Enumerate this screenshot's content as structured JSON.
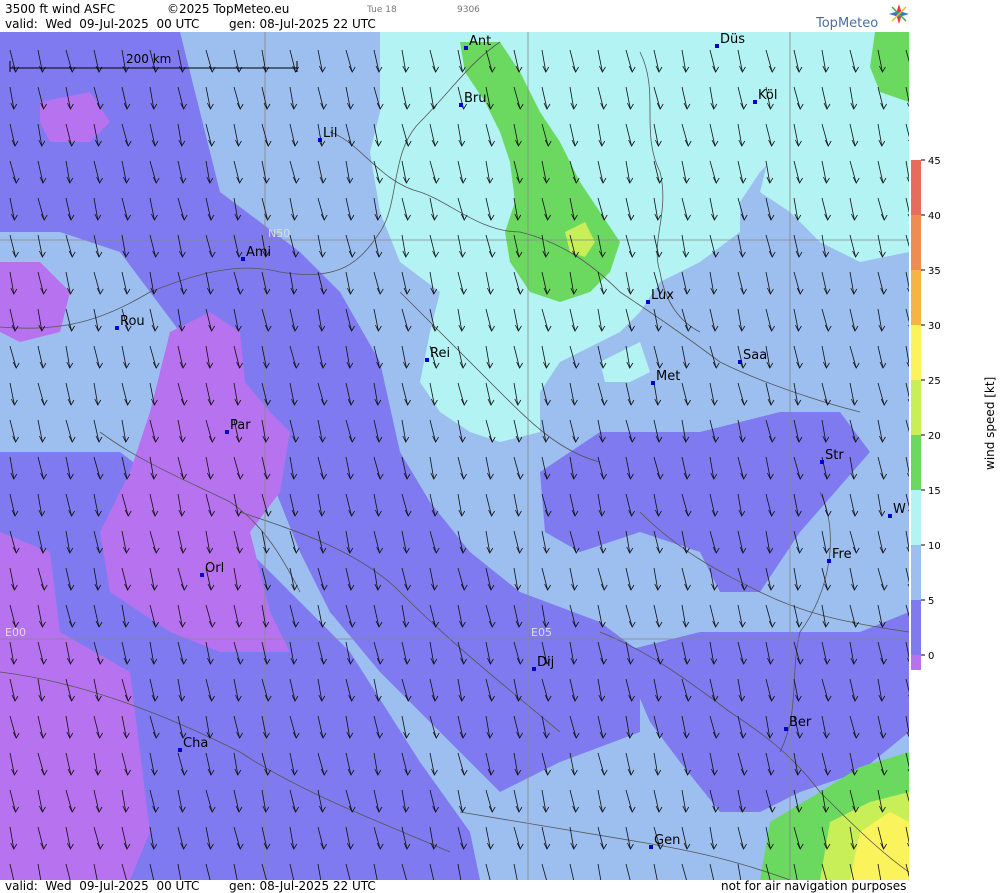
{
  "header": {
    "title": "3500 ft wind ASFC",
    "copyright": "©2025 TopMeteo.eu",
    "day_code": "Tue 18",
    "run_code": "9306",
    "valid": "valid:  Wed  09-Jul-2025  00 UTC",
    "generated": "gen: 08-Jul-2025 22 UTC"
  },
  "footer": {
    "valid": "valid:  Wed  09-Jul-2025  00 UTC",
    "generated": "gen: 08-Jul-2025 22 UTC",
    "disclaimer": "not for air navigation purposes"
  },
  "logo": {
    "text": "TopMeteo",
    "icon": "compass-star-icon"
  },
  "scale": {
    "label": "200 km"
  },
  "grid_labels": {
    "lat": "N50",
    "lon_west": "E00",
    "lon_east": "E05"
  },
  "cities": [
    {
      "name": "Ant"
    },
    {
      "name": "Düs"
    },
    {
      "name": "Bru"
    },
    {
      "name": "Köl"
    },
    {
      "name": "Lil"
    },
    {
      "name": "Ami"
    },
    {
      "name": "Lux"
    },
    {
      "name": "Rou"
    },
    {
      "name": "Rei"
    },
    {
      "name": "Saa"
    },
    {
      "name": "Met"
    },
    {
      "name": "Par"
    },
    {
      "name": "Str"
    },
    {
      "name": "W"
    },
    {
      "name": "Fre"
    },
    {
      "name": "Orl"
    },
    {
      "name": "Dij"
    },
    {
      "name": "Ber"
    },
    {
      "name": "Cha"
    },
    {
      "name": "Gen"
    }
  ],
  "legend": {
    "title": "wind speed [kt]",
    "ticks": [
      "45",
      "40",
      "35",
      "30",
      "25",
      "20",
      "15",
      "10",
      "5",
      "0"
    ],
    "colors": [
      "#b772f0",
      "#7f7af0",
      "#9dbff0",
      "#b3f3f3",
      "#6bd960",
      "#c8ef58",
      "#fbf35c",
      "#f5b545",
      "#ee8c52",
      "#e86c5c"
    ]
  },
  "wind_direction": "north to south-southwest (arrows pointing down)"
}
